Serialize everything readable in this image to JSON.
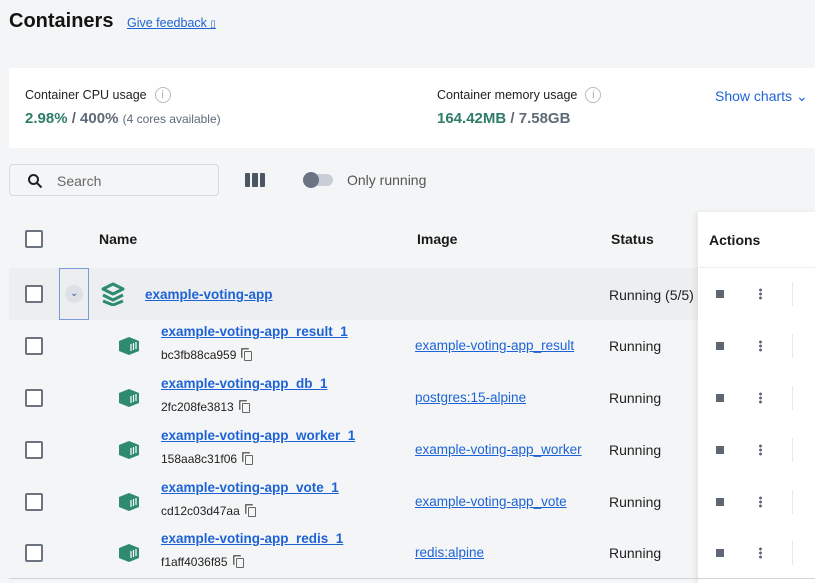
{
  "header": {
    "title": "Containers",
    "feedback": "Give feedback"
  },
  "stats": {
    "cpu_label": "Container CPU usage",
    "cpu_used": "2.98%",
    "cpu_total": " / 400%",
    "cpu_note": "(4 cores available)",
    "mem_label": "Container memory usage",
    "mem_used": "164.42MB",
    "mem_total": " / 7.58GB",
    "show_charts": "Show charts"
  },
  "toolbar": {
    "search_placeholder": "Search",
    "only_running": "Only running"
  },
  "table": {
    "headers": {
      "name": "Name",
      "image": "Image",
      "status": "Status",
      "actions": "Actions"
    },
    "group": {
      "name": "example-voting-app",
      "status": "Running (5/5)"
    },
    "rows": [
      {
        "name": "example-voting-app_result_1",
        "id": "bc3fb88ca959",
        "image": "example-voting-app_result",
        "status": "Running"
      },
      {
        "name": "example-voting-app_db_1",
        "id": "2fc208fe3813",
        "image": "postgres:15-alpine",
        "status": "Running"
      },
      {
        "name": "example-voting-app_worker_1",
        "id": "158aa8c31f06",
        "image": "example-voting-app_worker",
        "status": "Running"
      },
      {
        "name": "example-voting-app_vote_1",
        "id": "cd12c03d47aa",
        "image": "example-voting-app_vote",
        "status": "Running"
      },
      {
        "name": "example-voting-app_redis_1",
        "id": "f1aff4036f85",
        "image": "redis:alpine",
        "status": "Running"
      }
    ]
  },
  "colors": {
    "accent": "#1d63d6",
    "brand_green": "#2e7d68"
  }
}
